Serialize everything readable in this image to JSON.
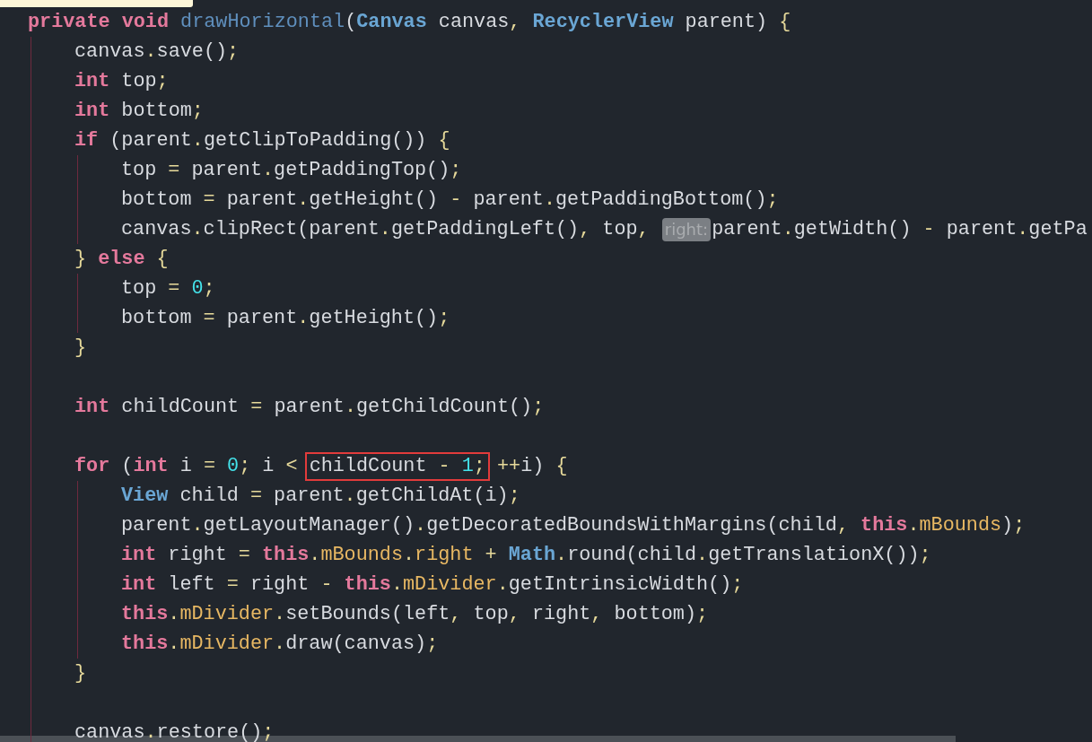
{
  "editor": {
    "lines": [
      {
        "kind": "code",
        "tokens": [
          {
            "kind": "keyword",
            "text": "private "
          },
          {
            "kind": "keyword",
            "text": "void "
          },
          {
            "kind": "method",
            "text": "drawHorizontal"
          },
          {
            "kind": "plain",
            "text": "("
          },
          {
            "kind": "type",
            "text": "Canvas"
          },
          {
            "kind": "plain",
            "text": " canvas"
          },
          {
            "kind": "punct",
            "text": ", "
          },
          {
            "kind": "type",
            "text": "RecyclerView"
          },
          {
            "kind": "plain",
            "text": " parent) "
          },
          {
            "kind": "punct",
            "text": "{"
          }
        ],
        "children": [
          {
            "kind": "code",
            "tokens": [
              {
                "kind": "plain",
                "text": "canvas"
              },
              {
                "kind": "punct",
                "text": "."
              },
              {
                "kind": "plain",
                "text": "save()"
              },
              {
                "kind": "punct",
                "text": ";"
              }
            ]
          },
          {
            "kind": "code",
            "tokens": [
              {
                "kind": "keyword",
                "text": "int"
              },
              {
                "kind": "plain",
                "text": " top"
              },
              {
                "kind": "punct",
                "text": ";"
              }
            ]
          },
          {
            "kind": "code",
            "tokens": [
              {
                "kind": "keyword",
                "text": "int"
              },
              {
                "kind": "plain",
                "text": " bottom"
              },
              {
                "kind": "punct",
                "text": ";"
              }
            ]
          },
          {
            "kind": "code",
            "tokens": [
              {
                "kind": "keyword",
                "text": "if"
              },
              {
                "kind": "plain",
                "text": " (parent"
              },
              {
                "kind": "punct",
                "text": "."
              },
              {
                "kind": "plain",
                "text": "getClipToPadding()) "
              },
              {
                "kind": "punct",
                "text": "{"
              }
            ],
            "children": [
              {
                "kind": "code",
                "tokens": [
                  {
                    "kind": "plain",
                    "text": "top "
                  },
                  {
                    "kind": "punct",
                    "text": "= "
                  },
                  {
                    "kind": "plain",
                    "text": "parent"
                  },
                  {
                    "kind": "punct",
                    "text": "."
                  },
                  {
                    "kind": "plain",
                    "text": "getPaddingTop()"
                  },
                  {
                    "kind": "punct",
                    "text": ";"
                  }
                ]
              },
              {
                "kind": "code",
                "tokens": [
                  {
                    "kind": "plain",
                    "text": "bottom "
                  },
                  {
                    "kind": "punct",
                    "text": "="
                  },
                  {
                    "kind": "plain",
                    "text": " parent"
                  },
                  {
                    "kind": "punct",
                    "text": "."
                  },
                  {
                    "kind": "plain",
                    "text": "getHeight() "
                  },
                  {
                    "kind": "punct",
                    "text": "-"
                  },
                  {
                    "kind": "plain",
                    "text": " parent"
                  },
                  {
                    "kind": "punct",
                    "text": "."
                  },
                  {
                    "kind": "plain",
                    "text": "getPaddingBottom()"
                  },
                  {
                    "kind": "punct",
                    "text": ";"
                  }
                ]
              },
              {
                "kind": "code",
                "tokens": [
                  {
                    "kind": "plain",
                    "text": "canvas"
                  },
                  {
                    "kind": "punct",
                    "text": "."
                  },
                  {
                    "kind": "plain",
                    "text": "clipRect(parent"
                  },
                  {
                    "kind": "punct",
                    "text": "."
                  },
                  {
                    "kind": "plain",
                    "text": "getPaddingLeft()"
                  },
                  {
                    "kind": "punct",
                    "text": ","
                  },
                  {
                    "kind": "plain",
                    "text": " top"
                  },
                  {
                    "kind": "punct",
                    "text": ", "
                  },
                  {
                    "kind": "hint",
                    "text": "right:"
                  },
                  {
                    "kind": "plain",
                    "text": "parent"
                  },
                  {
                    "kind": "punct",
                    "text": "."
                  },
                  {
                    "kind": "plain",
                    "text": "getWidth() "
                  },
                  {
                    "kind": "punct",
                    "text": "-"
                  },
                  {
                    "kind": "plain",
                    "text": " parent"
                  },
                  {
                    "kind": "punct",
                    "text": "."
                  },
                  {
                    "kind": "plain",
                    "text": "getPa"
                  }
                ]
              }
            ]
          },
          {
            "kind": "code",
            "tokens": [
              {
                "kind": "punct",
                "text": "} "
              },
              {
                "kind": "keyword",
                "text": "else "
              },
              {
                "kind": "punct",
                "text": "{"
              }
            ],
            "children": [
              {
                "kind": "code",
                "tokens": [
                  {
                    "kind": "plain",
                    "text": "top "
                  },
                  {
                    "kind": "punct",
                    "text": "= "
                  },
                  {
                    "kind": "number",
                    "text": "0"
                  },
                  {
                    "kind": "punct",
                    "text": ";"
                  }
                ]
              },
              {
                "kind": "code",
                "tokens": [
                  {
                    "kind": "plain",
                    "text": "bottom "
                  },
                  {
                    "kind": "punct",
                    "text": "="
                  },
                  {
                    "kind": "plain",
                    "text": " parent"
                  },
                  {
                    "kind": "punct",
                    "text": "."
                  },
                  {
                    "kind": "plain",
                    "text": "getHeight()"
                  },
                  {
                    "kind": "punct",
                    "text": ";"
                  }
                ]
              }
            ]
          },
          {
            "kind": "code",
            "tokens": [
              {
                "kind": "punct",
                "text": "}"
              }
            ]
          },
          {
            "kind": "blank"
          },
          {
            "kind": "code",
            "tokens": [
              {
                "kind": "keyword",
                "text": "int"
              },
              {
                "kind": "plain",
                "text": " childCount "
              },
              {
                "kind": "punct",
                "text": "="
              },
              {
                "kind": "plain",
                "text": " parent"
              },
              {
                "kind": "punct",
                "text": "."
              },
              {
                "kind": "plain",
                "text": "getChildCount()"
              },
              {
                "kind": "punct",
                "text": ";"
              }
            ]
          },
          {
            "kind": "blank"
          },
          {
            "kind": "code",
            "tokens": [
              {
                "kind": "keyword",
                "text": "for"
              },
              {
                "kind": "plain",
                "text": " ("
              },
              {
                "kind": "keyword",
                "text": "int"
              },
              {
                "kind": "plain",
                "text": " i "
              },
              {
                "kind": "punct",
                "text": "= "
              },
              {
                "kind": "number",
                "text": "0"
              },
              {
                "kind": "punct",
                "text": ";"
              },
              {
                "kind": "plain",
                "text": " i "
              },
              {
                "kind": "punct",
                "text": "< "
              },
              {
                "kind": "outlined",
                "tokens": [
                  {
                    "kind": "plain",
                    "text": "childCount "
                  },
                  {
                    "kind": "punct",
                    "text": "- "
                  },
                  {
                    "kind": "number",
                    "text": "1"
                  },
                  {
                    "kind": "punct",
                    "text": ";"
                  }
                ]
              },
              {
                "kind": "punct",
                "text": " ++"
              },
              {
                "kind": "plain",
                "text": "i) "
              },
              {
                "kind": "punct",
                "text": "{"
              }
            ],
            "children": [
              {
                "kind": "code",
                "tokens": [
                  {
                    "kind": "type",
                    "text": "View"
                  },
                  {
                    "kind": "plain",
                    "text": " child "
                  },
                  {
                    "kind": "punct",
                    "text": "="
                  },
                  {
                    "kind": "plain",
                    "text": " parent"
                  },
                  {
                    "kind": "punct",
                    "text": "."
                  },
                  {
                    "kind": "plain",
                    "text": "getChildAt(i)"
                  },
                  {
                    "kind": "punct",
                    "text": ";"
                  }
                ]
              },
              {
                "kind": "code",
                "tokens": [
                  {
                    "kind": "plain",
                    "text": "parent"
                  },
                  {
                    "kind": "punct",
                    "text": "."
                  },
                  {
                    "kind": "plain",
                    "text": "getLayoutManager()"
                  },
                  {
                    "kind": "punct",
                    "text": "."
                  },
                  {
                    "kind": "plain",
                    "text": "getDecoratedBoundsWithMargins(child"
                  },
                  {
                    "kind": "punct",
                    "text": ", "
                  },
                  {
                    "kind": "keyword",
                    "text": "this"
                  },
                  {
                    "kind": "punct",
                    "text": "."
                  },
                  {
                    "kind": "field",
                    "text": "mBounds"
                  },
                  {
                    "kind": "plain",
                    "text": ")"
                  },
                  {
                    "kind": "punct",
                    "text": ";"
                  }
                ]
              },
              {
                "kind": "code",
                "tokens": [
                  {
                    "kind": "keyword",
                    "text": "int"
                  },
                  {
                    "kind": "plain",
                    "text": " right "
                  },
                  {
                    "kind": "punct",
                    "text": "= "
                  },
                  {
                    "kind": "keyword",
                    "text": "this"
                  },
                  {
                    "kind": "punct",
                    "text": "."
                  },
                  {
                    "kind": "field",
                    "text": "mBounds"
                  },
                  {
                    "kind": "punct",
                    "text": "."
                  },
                  {
                    "kind": "field",
                    "text": "right"
                  },
                  {
                    "kind": "punct",
                    "text": " + "
                  },
                  {
                    "kind": "type",
                    "text": "Math"
                  },
                  {
                    "kind": "punct",
                    "text": "."
                  },
                  {
                    "kind": "plain",
                    "text": "round(child"
                  },
                  {
                    "kind": "punct",
                    "text": "."
                  },
                  {
                    "kind": "plain",
                    "text": "getTranslationX())"
                  },
                  {
                    "kind": "punct",
                    "text": ";"
                  }
                ]
              },
              {
                "kind": "code",
                "tokens": [
                  {
                    "kind": "keyword",
                    "text": "int"
                  },
                  {
                    "kind": "plain",
                    "text": " left "
                  },
                  {
                    "kind": "punct",
                    "text": "="
                  },
                  {
                    "kind": "plain",
                    "text": " right "
                  },
                  {
                    "kind": "punct",
                    "text": "- "
                  },
                  {
                    "kind": "keyword",
                    "text": "this"
                  },
                  {
                    "kind": "punct",
                    "text": "."
                  },
                  {
                    "kind": "field",
                    "text": "mDivider"
                  },
                  {
                    "kind": "punct",
                    "text": "."
                  },
                  {
                    "kind": "plain",
                    "text": "getIntrinsicWidth()"
                  },
                  {
                    "kind": "punct",
                    "text": ";"
                  }
                ]
              },
              {
                "kind": "code",
                "tokens": [
                  {
                    "kind": "keyword",
                    "text": "this"
                  },
                  {
                    "kind": "punct",
                    "text": "."
                  },
                  {
                    "kind": "field",
                    "text": "mDivider"
                  },
                  {
                    "kind": "punct",
                    "text": "."
                  },
                  {
                    "kind": "plain",
                    "text": "setBounds(left"
                  },
                  {
                    "kind": "punct",
                    "text": ","
                  },
                  {
                    "kind": "plain",
                    "text": " top"
                  },
                  {
                    "kind": "punct",
                    "text": ","
                  },
                  {
                    "kind": "plain",
                    "text": " right"
                  },
                  {
                    "kind": "punct",
                    "text": ","
                  },
                  {
                    "kind": "plain",
                    "text": " bottom)"
                  },
                  {
                    "kind": "punct",
                    "text": ";"
                  }
                ]
              },
              {
                "kind": "code",
                "tokens": [
                  {
                    "kind": "keyword",
                    "text": "this"
                  },
                  {
                    "kind": "punct",
                    "text": "."
                  },
                  {
                    "kind": "field",
                    "text": "mDivider"
                  },
                  {
                    "kind": "punct",
                    "text": "."
                  },
                  {
                    "kind": "plain",
                    "text": "draw(canvas)"
                  },
                  {
                    "kind": "punct",
                    "text": ";"
                  }
                ]
              }
            ]
          },
          {
            "kind": "code",
            "tokens": [
              {
                "kind": "punct",
                "text": "}"
              }
            ]
          },
          {
            "kind": "blank"
          },
          {
            "kind": "code",
            "tokens": [
              {
                "kind": "plain",
                "text": "canvas"
              },
              {
                "kind": "punct",
                "text": "."
              },
              {
                "kind": "plain",
                "text": "restore()"
              },
              {
                "kind": "punct",
                "text": ";"
              }
            ]
          }
        ]
      }
    ]
  }
}
